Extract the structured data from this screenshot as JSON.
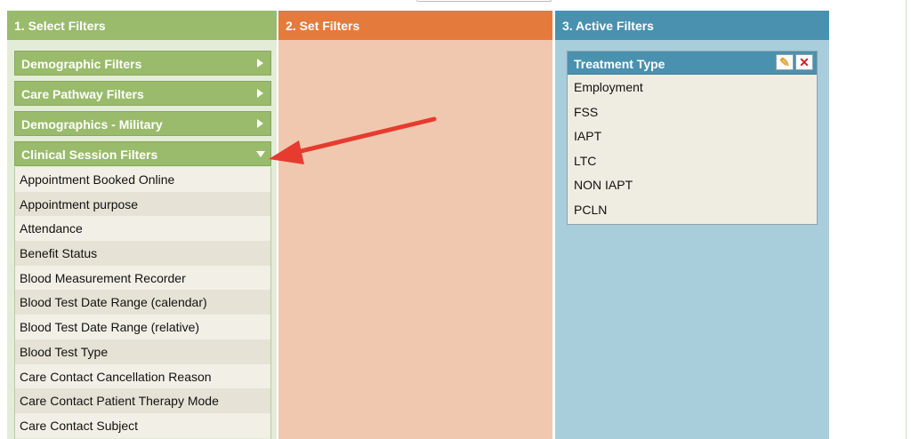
{
  "col1": {
    "header": "1. Select Filters",
    "accordions": [
      {
        "label": "Demographic Filters",
        "expanded": false
      },
      {
        "label": "Care Pathway Filters",
        "expanded": false
      },
      {
        "label": "Demographics - Military",
        "expanded": false
      },
      {
        "label": "Clinical Session Filters",
        "expanded": true
      }
    ],
    "items": [
      "Appointment Booked Online",
      "Appointment purpose",
      "Attendance",
      "Benefit Status",
      "Blood Measurement Recorder",
      "Blood Test Date Range (calendar)",
      "Blood Test Date Range (relative)",
      "Blood Test Type",
      "Care Contact Cancellation Reason",
      "Care Contact Patient Therapy Mode",
      "Care Contact Subject"
    ]
  },
  "col2": {
    "header": "2. Set Filters"
  },
  "col3": {
    "header": "3. Active Filters",
    "filter": {
      "title": "Treatment Type",
      "values": [
        "Employment",
        "FSS",
        "IAPT",
        "LTC",
        "NON IAPT",
        "PCLN"
      ]
    }
  },
  "colors": {
    "select_header": "#99bb6b",
    "set_header": "#e47b3c",
    "active_header": "#4a91af",
    "annotation_arrow": "#e63b2e"
  },
  "icons": {
    "edit": "edit-icon",
    "delete": "delete-icon",
    "expand": "triangle-right-icon",
    "collapse": "triangle-down-icon"
  }
}
